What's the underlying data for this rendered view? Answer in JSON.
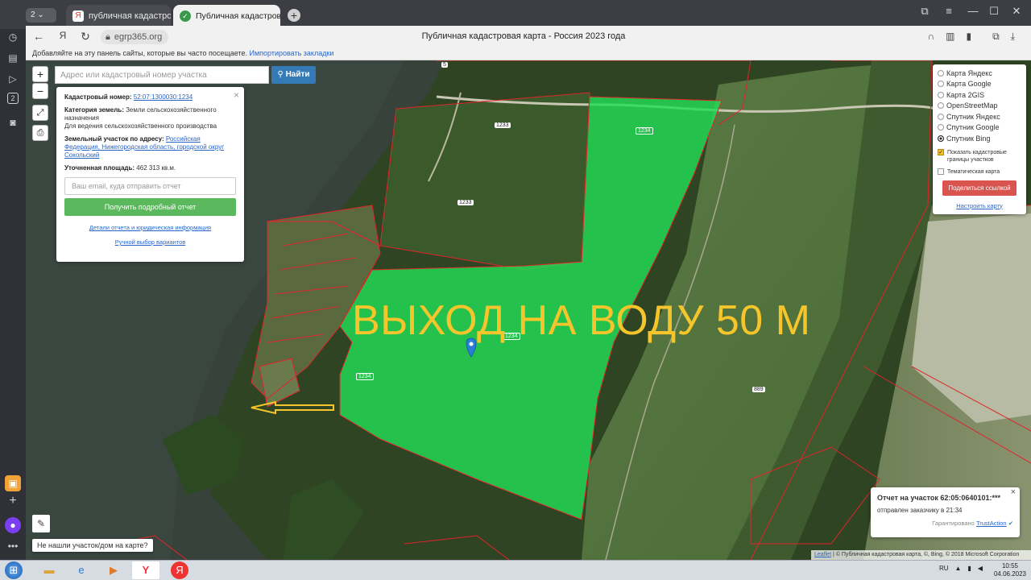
{
  "browser": {
    "tab_count": "2",
    "tabs": [
      {
        "label": "публичная кадастровая к",
        "active": false
      },
      {
        "label": "Публичная кадастровая карта",
        "active": true
      }
    ],
    "url": "egrp365.org",
    "page_title": "Публичная кадастровая карта - Россия 2023 года",
    "bookmark_hint": "Добавляйте на эту панель сайты, которые вы часто посещаете.",
    "bookmark_import": "Импортировать закладки",
    "sidebar_badge": "2"
  },
  "map": {
    "search_placeholder": "Адрес или кадастровый номер участка",
    "search_button": "Найти",
    "zoom_in": "+",
    "zoom_out": "−",
    "overlay_text": "ВЫХОД НА ВОДУ 50 М",
    "parcel_labels": [
      "1233",
      "1233",
      "1234",
      "1234",
      "1234",
      "889",
      "5"
    ],
    "not_found": "Не нашли участок/дом на карте?",
    "attribution_leaflet": "Leaflet",
    "attribution_rest": " | © Публичная кадастровая карта, ©, Bing, © 2018 Microsoft Corporation"
  },
  "info": {
    "cad_label": "Кадастровый номер:",
    "cad_value": "52:07:1300030:1234",
    "category_label": "Категория земель:",
    "category_value": "Земли сельскохозяйственного назначения",
    "usage": "Для ведения сельскохозяйственного производства",
    "address_label": "Земельный участок по адресу:",
    "address_value": "Российская Федерация, Нижегородская область, городской округ Сокольский",
    "area_label": "Уточненная площадь:",
    "area_value": "462 313 кв.м.",
    "email_placeholder": "Ваш email, куда отправить отчет",
    "report_button": "Получить подробный отчет",
    "details_link": "Детали отчета и юридическая информация",
    "manual_link": "Ручной выбор вариантов"
  },
  "layers": {
    "options": [
      {
        "label": "Карта Яндекс",
        "selected": false
      },
      {
        "label": "Карта Google",
        "selected": false
      },
      {
        "label": "Карта 2GIS",
        "selected": false
      },
      {
        "label": "OpenStreetMap",
        "selected": false
      },
      {
        "label": "Спутник Яндекс",
        "selected": false
      },
      {
        "label": "Спутник Google",
        "selected": false
      },
      {
        "label": "Спутник Bing",
        "selected": true
      }
    ],
    "show_borders": "Показать кадастровые границы участков",
    "thematic": "Тематическая карта",
    "share": "Поделиться ссылкой",
    "configure": "Настроить карту"
  },
  "toast": {
    "title": "Отчет на участок 62:05:0640101:***",
    "sent": "отправлен заказчику в 21:34",
    "guarantee": "Гарантировано",
    "trustaction": "TrustAction"
  },
  "taskbar": {
    "lang": "RU",
    "time": "10:55",
    "date": "04.06.2023"
  },
  "colors": {
    "parcel_fill": "#22dd55",
    "overlay_text": "#f5c52b",
    "search_button": "#337ab7",
    "report_button": "#5cb85c",
    "share_button": "#d9534f"
  }
}
